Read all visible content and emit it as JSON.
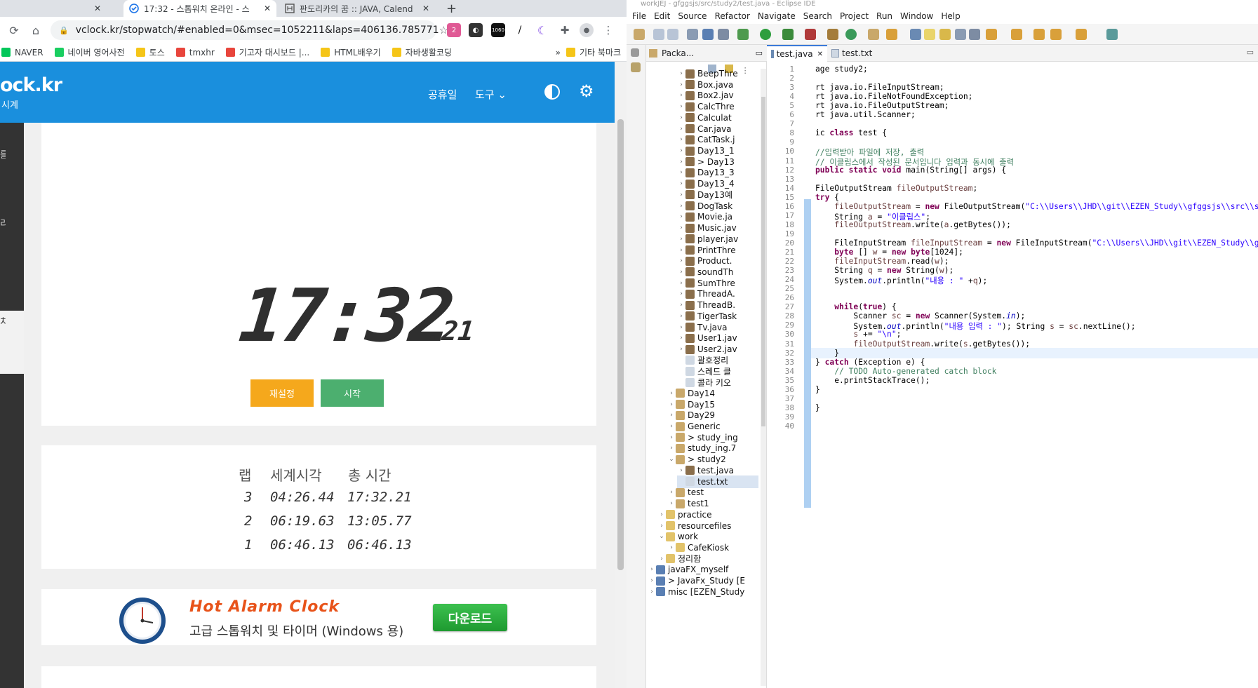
{
  "browser": {
    "tabs": [
      {
        "title": "",
        "close": "✕"
      },
      {
        "title": "17:32 - 스톱워치 온라인 - 스",
        "close": "✕"
      },
      {
        "title": "판도리카의 꿈 :: JAVA, Calend",
        "close": "✕"
      }
    ],
    "new_tab": "+",
    "url": "vclock.kr/stopwatch/#enabled=0&msec=1052211&laps=406136.785771",
    "bookmarks": [
      "NAVER",
      "네이버 영어사전",
      "토스",
      "tmxhr",
      "기고자 대시보드 |...",
      "HTML배우기",
      "자바생활코딩"
    ],
    "bookmarks_more": "»",
    "other_bookmarks": "기타 북마크",
    "ext_badge": "2",
    "ext_label": "1060"
  },
  "site": {
    "logo": "ock.kr",
    "logo_sub": "시계",
    "nav": {
      "holiday": "공휴일",
      "tools": "도구 ⌄"
    },
    "sidebar_labels": [
      "를",
      "리",
      "치"
    ],
    "clock": {
      "main": "17:32",
      "ms": ".21"
    },
    "buttons": {
      "reset": "재설정",
      "start": "시작"
    },
    "colors": {
      "header": "#1a8fdd",
      "reset": "#f5a81c",
      "start": "#4caf6f"
    },
    "laps": {
      "headers": [
        "랩",
        "세계시각",
        "총 시간"
      ],
      "rows": [
        {
          "lap": "3",
          "world": "04:26.44",
          "total": "17:32.21"
        },
        {
          "lap": "2",
          "world": "06:19.63",
          "total": "13:05.77"
        },
        {
          "lap": "1",
          "world": "06:46.13",
          "total": "06:46.13"
        }
      ]
    },
    "ad": {
      "title": "Hot Alarm Clock",
      "subtitle": "고급 스톱워치 및 타이머 (Windows 용)",
      "button": "다운로드"
    }
  },
  "eclipse": {
    "title": "workJEJ - gfggsjs/src/study2/test.java - Eclipse IDE",
    "menu": [
      "File",
      "Edit",
      "Source",
      "Refactor",
      "Navigate",
      "Search",
      "Project",
      "Run",
      "Window",
      "Help"
    ],
    "explorer_tab": "Packa...",
    "editor_tabs": [
      "test.java",
      "test.txt"
    ],
    "tree": [
      {
        "label": "BeepThre",
        "depth": 3,
        "type": "java"
      },
      {
        "label": "Box.java",
        "depth": 3,
        "type": "java"
      },
      {
        "label": "Box2.jav",
        "depth": 3,
        "type": "java"
      },
      {
        "label": "CalcThre",
        "depth": 3,
        "type": "java"
      },
      {
        "label": "Calculat",
        "depth": 3,
        "type": "java"
      },
      {
        "label": "Car.java",
        "depth": 3,
        "type": "java"
      },
      {
        "label": "CatTask.j",
        "depth": 3,
        "type": "java"
      },
      {
        "label": "Day13_1",
        "depth": 3,
        "type": "java"
      },
      {
        "label": "> Day13",
        "depth": 3,
        "type": "java"
      },
      {
        "label": "Day13_3",
        "depth": 3,
        "type": "java"
      },
      {
        "label": "Day13_4",
        "depth": 3,
        "type": "java"
      },
      {
        "label": "Day13예",
        "depth": 3,
        "type": "java"
      },
      {
        "label": "DogTask",
        "depth": 3,
        "type": "java"
      },
      {
        "label": "Movie.ja",
        "depth": 3,
        "type": "java"
      },
      {
        "label": "Music.jav",
        "depth": 3,
        "type": "java"
      },
      {
        "label": "player.jav",
        "depth": 3,
        "type": "java"
      },
      {
        "label": "PrintThre",
        "depth": 3,
        "type": "java"
      },
      {
        "label": "Product.",
        "depth": 3,
        "type": "java"
      },
      {
        "label": "soundTh",
        "depth": 3,
        "type": "java"
      },
      {
        "label": "SumThre",
        "depth": 3,
        "type": "java"
      },
      {
        "label": "ThreadA.",
        "depth": 3,
        "type": "java"
      },
      {
        "label": "ThreadB.",
        "depth": 3,
        "type": "java"
      },
      {
        "label": "TigerTask",
        "depth": 3,
        "type": "java"
      },
      {
        "label": "Tv.java",
        "depth": 3,
        "type": "java"
      },
      {
        "label": "User1.jav",
        "depth": 3,
        "type": "java"
      },
      {
        "label": "User2.jav",
        "depth": 3,
        "type": "java"
      },
      {
        "label": "괄호정리",
        "depth": 3,
        "type": "file"
      },
      {
        "label": "스레드 클",
        "depth": 3,
        "type": "file"
      },
      {
        "label": "콜라 키오",
        "depth": 3,
        "type": "file"
      },
      {
        "label": "Day14",
        "depth": 2,
        "type": "pkg"
      },
      {
        "label": "Day15",
        "depth": 2,
        "type": "pkg"
      },
      {
        "label": "Day29",
        "depth": 2,
        "type": "pkg"
      },
      {
        "label": "Generic",
        "depth": 2,
        "type": "pkg"
      },
      {
        "label": "> study_ing",
        "depth": 2,
        "type": "pkg"
      },
      {
        "label": "study_ing.7",
        "depth": 2,
        "type": "pkg"
      },
      {
        "label": "> study2",
        "depth": 2,
        "type": "pkg",
        "open": true
      },
      {
        "label": "test.java",
        "depth": 3,
        "type": "java"
      },
      {
        "label": "test.txt",
        "depth": 3,
        "type": "file",
        "selected": true
      },
      {
        "label": "test",
        "depth": 2,
        "type": "pkg"
      },
      {
        "label": "test1",
        "depth": 2,
        "type": "pkg"
      },
      {
        "label": "practice",
        "depth": 1,
        "type": "folder"
      },
      {
        "label": "resourcefiles",
        "depth": 1,
        "type": "folder"
      },
      {
        "label": "work",
        "depth": 1,
        "type": "folder",
        "open": true
      },
      {
        "label": "CafeKiosk",
        "depth": 2,
        "type": "folder"
      },
      {
        "label": "정리함",
        "depth": 1,
        "type": "folder"
      },
      {
        "label": "javaFX_myself",
        "depth": 0,
        "type": "project"
      },
      {
        "label": "> JavaFx_Study [E",
        "depth": 0,
        "type": "project"
      },
      {
        "label": "misc [EZEN_Study",
        "depth": 0,
        "type": "project"
      }
    ],
    "code": [
      "age study2;",
      "",
      "rt java.io.FileInputStream;",
      "rt java.io.FileNotFoundException;",
      "rt java.io.FileOutputStream;",
      "rt java.util.Scanner;",
      "",
      "ic class test {",
      "",
      "//입력받아 파일에 저장, 출력",
      "// 이클립스에서 작성된 문서입니다 입력과 동시에 출력",
      "public static void main(String[] args) {",
      "",
      "FileOutputStream fileOutputStream;",
      "try {",
      "    fileOutputStream = new FileOutputStream(\"C:\\\\Users\\\\JHD\\\\git\\\\EZEN_Study\\\\gfggsjs\\\\src\\\\study",
      "    String a = \"이클립스\";",
      "    fileOutputStream.write(a.getBytes());",
      "",
      "    FileInputStream fileInputStream = new FileInputStream(\"C:\\\\Users\\\\JHD\\\\git\\\\EZEN_Study\\\\gfggs",
      "    byte [] w = new byte[1024];",
      "    fileInputStream.read(w);",
      "    String q = new String(w);",
      "    System.out.println(\"내용 : \" +q);",
      "",
      "",
      "    while(true) {",
      "        Scanner sc = new Scanner(System.in);",
      "        System.out.println(\"내용 입력 : \"); String s = sc.nextLine();",
      "        s += \"\\n\";",
      "        fileOutputStream.write(s.getBytes());",
      "    }",
      "} catch (Exception e) {",
      "    // TODO Auto-generated catch block",
      "    e.printStackTrace();",
      "}",
      "",
      "}",
      "",
      ""
    ]
  }
}
